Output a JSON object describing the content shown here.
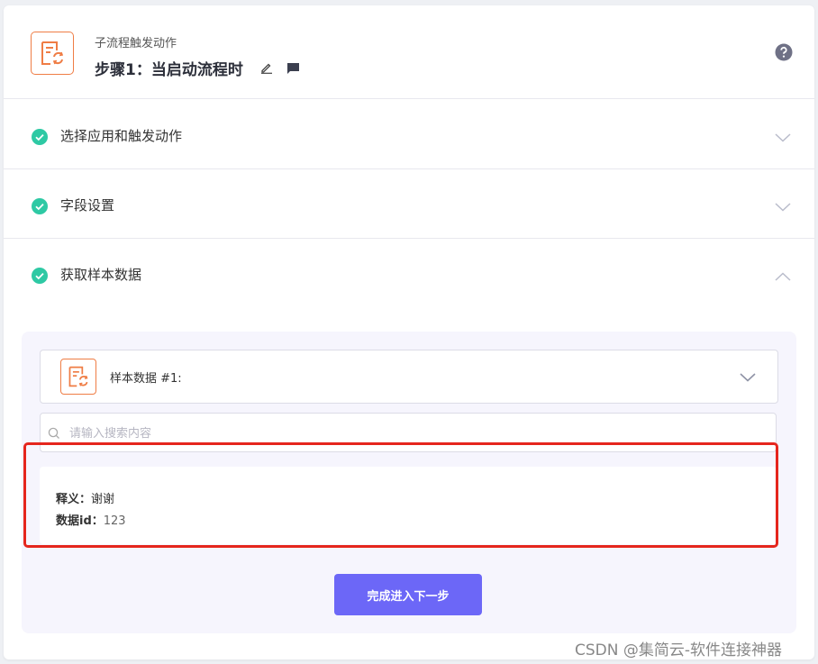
{
  "header": {
    "subtitle": "子流程触发动作",
    "title": "步骤1：当启动流程时",
    "app_icon": "document-refresh-icon",
    "edit_icon": "pencil-icon",
    "comment_icon": "comment-icon",
    "help_icon": "question-circle-icon"
  },
  "sections": [
    {
      "label": "选择应用和触发动作",
      "status": "completed",
      "expanded": false
    },
    {
      "label": "字段设置",
      "status": "completed",
      "expanded": false
    },
    {
      "label": "获取样本数据",
      "status": "completed",
      "expanded": true
    }
  ],
  "sample": {
    "label": "样本数据 #1:",
    "search_placeholder": "请输入搜索内容",
    "fields": [
      {
        "key": "释义：",
        "value": "谢谢"
      },
      {
        "key": "数据id：",
        "value": "123"
      }
    ]
  },
  "actions": {
    "next_label": "完成进入下一步"
  },
  "colors": {
    "accent": "#6c67f7",
    "check": "#2ec9a4",
    "app_icon": "#ef7d45",
    "highlight": "#e5261d"
  },
  "watermark": "CSDN @集简云-软件连接神器"
}
